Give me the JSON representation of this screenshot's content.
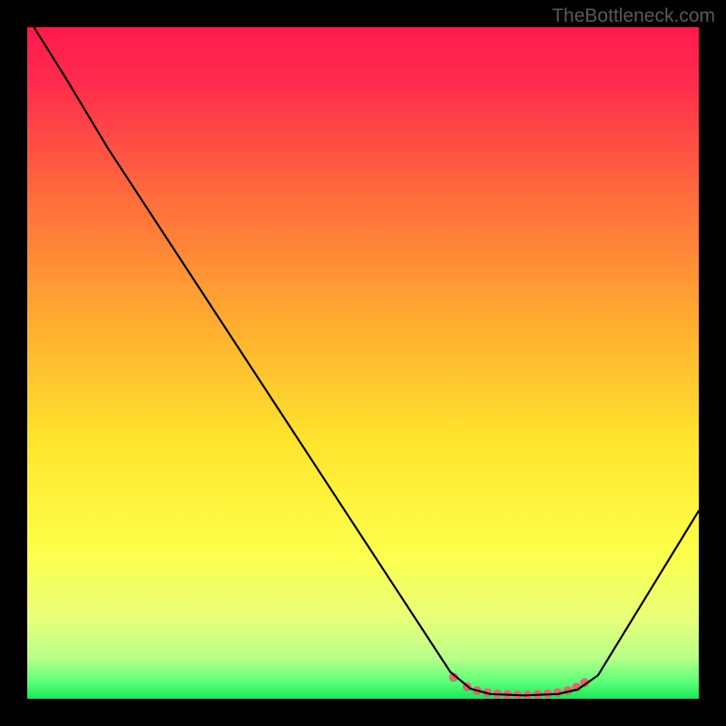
{
  "watermark": "TheBottleneck.com",
  "chart_data": {
    "type": "line",
    "title": "",
    "xlabel": "",
    "ylabel": "",
    "xlim": [
      0,
      100
    ],
    "ylim": [
      0,
      100
    ],
    "gradient_stops": [
      {
        "offset": 0,
        "color": "#ff1a4d"
      },
      {
        "offset": 0.08,
        "color": "#ff2b4d"
      },
      {
        "offset": 0.25,
        "color": "#ff6b3d"
      },
      {
        "offset": 0.45,
        "color": "#ffb030"
      },
      {
        "offset": 0.62,
        "color": "#ffe52e"
      },
      {
        "offset": 0.78,
        "color": "#fdff4a"
      },
      {
        "offset": 0.88,
        "color": "#e9ff7a"
      },
      {
        "offset": 0.94,
        "color": "#b8ff8a"
      },
      {
        "offset": 0.975,
        "color": "#5cff78"
      },
      {
        "offset": 1.0,
        "color": "#18e858"
      }
    ],
    "series": [
      {
        "name": "bottleneck-curve",
        "type": "path",
        "color": "#000000",
        "stroke_width": 2.2,
        "points": [
          {
            "x": 1,
            "y": 100
          },
          {
            "x": 6,
            "y": 92
          },
          {
            "x": 12,
            "y": 82
          },
          {
            "x": 63,
            "y": 4
          },
          {
            "x": 66,
            "y": 1.5
          },
          {
            "x": 69,
            "y": 0.7
          },
          {
            "x": 74,
            "y": 0.5
          },
          {
            "x": 79,
            "y": 0.7
          },
          {
            "x": 82,
            "y": 1.4
          },
          {
            "x": 85,
            "y": 3.5
          },
          {
            "x": 100,
            "y": 28
          }
        ]
      },
      {
        "name": "highlight-dots",
        "type": "scatter",
        "color": "#d96b6b",
        "radius": 5,
        "points": [
          {
            "x": 63.5,
            "y": 3.2
          },
          {
            "x": 65.5,
            "y": 1.8
          },
          {
            "x": 67,
            "y": 1.2
          },
          {
            "x": 68.5,
            "y": 0.9
          },
          {
            "x": 70,
            "y": 0.7
          },
          {
            "x": 71.5,
            "y": 0.6
          },
          {
            "x": 73,
            "y": 0.5
          },
          {
            "x": 74.5,
            "y": 0.5
          },
          {
            "x": 76,
            "y": 0.6
          },
          {
            "x": 77.5,
            "y": 0.7
          },
          {
            "x": 79,
            "y": 0.9
          },
          {
            "x": 80.5,
            "y": 1.2
          },
          {
            "x": 81.8,
            "y": 1.7
          },
          {
            "x": 83,
            "y": 2.4
          }
        ]
      }
    ]
  }
}
